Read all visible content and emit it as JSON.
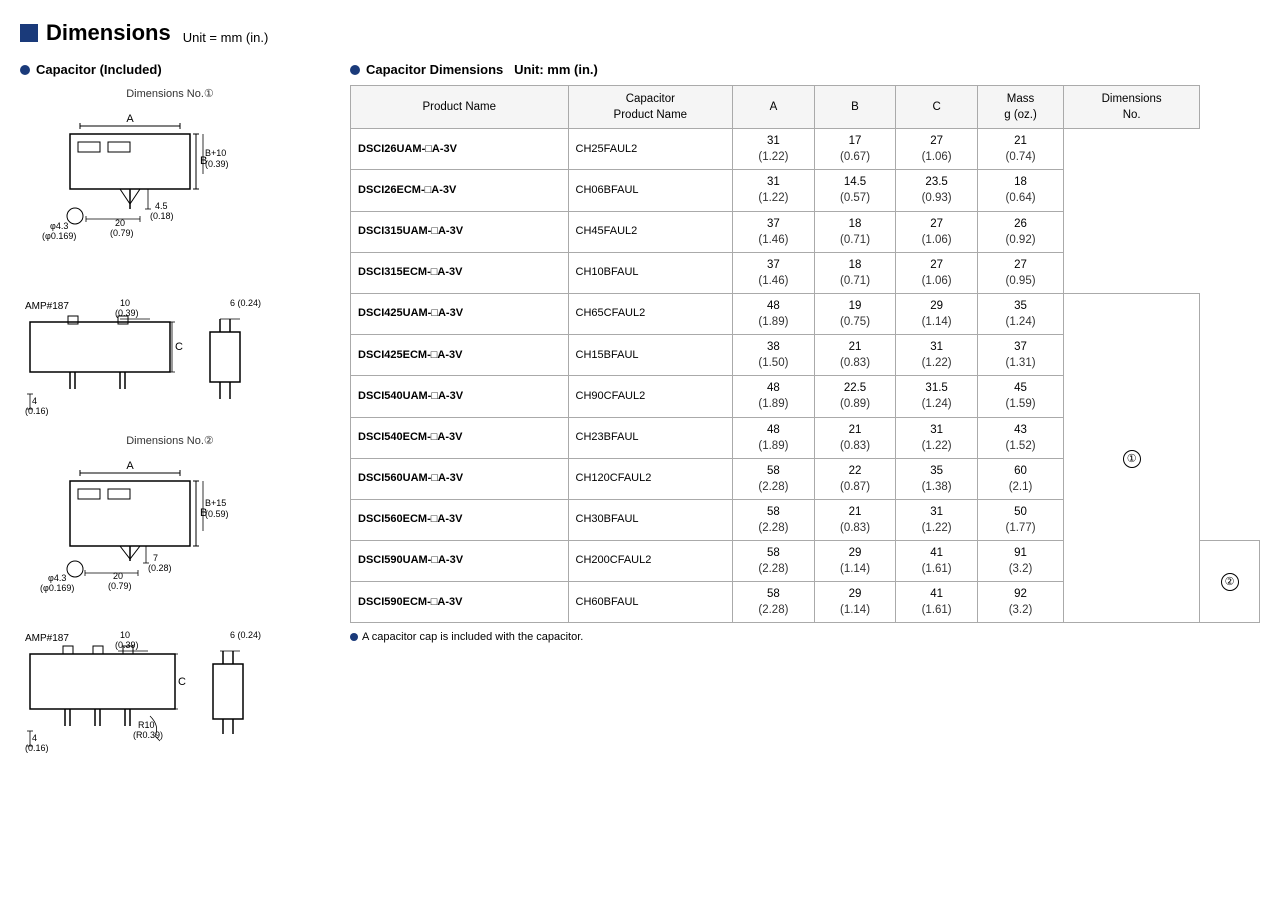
{
  "header": {
    "title": "Dimensions",
    "unit": "Unit = mm (in.)"
  },
  "left_section": {
    "title": "Capacitor (Included)",
    "dim1_label": "Dimensions No.①",
    "dim2_label": "Dimensions No.②"
  },
  "right_section": {
    "title": "Capacitor Dimensions",
    "unit": "Unit: mm (in.)",
    "columns": [
      "Product Name",
      "Capacitor\nProduct Name",
      "A",
      "B",
      "C",
      "Mass\ng (oz.)",
      "Dimensions\nNo."
    ],
    "rows": [
      {
        "product": "DSCI26UAM-□A-3V",
        "cap_product": "CH25FAUL2",
        "a": "31\n(1.22)",
        "b": "17\n(0.67)",
        "c": "27\n(1.06)",
        "mass": "21\n(0.74)",
        "dim_no": ""
      },
      {
        "product": "DSCI26ECM-□A-3V",
        "cap_product": "CH06BFAUL",
        "a": "31\n(1.22)",
        "b": "14.5\n(0.57)",
        "c": "23.5\n(0.93)",
        "mass": "18\n(0.64)",
        "dim_no": ""
      },
      {
        "product": "DSCI315UAM-□A-3V",
        "cap_product": "CH45FAUL2",
        "a": "37\n(1.46)",
        "b": "18\n(0.71)",
        "c": "27\n(1.06)",
        "mass": "26\n(0.92)",
        "dim_no": ""
      },
      {
        "product": "DSCI315ECM-□A-3V",
        "cap_product": "CH10BFAUL",
        "a": "37\n(1.46)",
        "b": "18\n(0.71)",
        "c": "27\n(1.06)",
        "mass": "27\n(0.95)",
        "dim_no": ""
      },
      {
        "product": "DSCI425UAM-□A-3V",
        "cap_product": "CH65CFAUL2",
        "a": "48\n(1.89)",
        "b": "19\n(0.75)",
        "c": "29\n(1.14)",
        "mass": "35\n(1.24)",
        "dim_no": "①"
      },
      {
        "product": "DSCI425ECM-□A-3V",
        "cap_product": "CH15BFAUL",
        "a": "38\n(1.50)",
        "b": "21\n(0.83)",
        "c": "31\n(1.22)",
        "mass": "37\n(1.31)",
        "dim_no": ""
      },
      {
        "product": "DSCI540UAM-□A-3V",
        "cap_product": "CH90CFAUL2",
        "a": "48\n(1.89)",
        "b": "22.5\n(0.89)",
        "c": "31.5\n(1.24)",
        "mass": "45\n(1.59)",
        "dim_no": ""
      },
      {
        "product": "DSCI540ECM-□A-3V",
        "cap_product": "CH23BFAUL",
        "a": "48\n(1.89)",
        "b": "21\n(0.83)",
        "c": "31\n(1.22)",
        "mass": "43\n(1.52)",
        "dim_no": ""
      },
      {
        "product": "DSCI560UAM-□A-3V",
        "cap_product": "CH120CFAUL2",
        "a": "58\n(2.28)",
        "b": "22\n(0.87)",
        "c": "35\n(1.38)",
        "mass": "60\n(2.1)",
        "dim_no": ""
      },
      {
        "product": "DSCI560ECM-□A-3V",
        "cap_product": "CH30BFAUL",
        "a": "58\n(2.28)",
        "b": "21\n(0.83)",
        "c": "31\n(1.22)",
        "mass": "50\n(1.77)",
        "dim_no": ""
      },
      {
        "product": "DSCI590UAM-□A-3V",
        "cap_product": "CH200CFAUL2",
        "a": "58\n(2.28)",
        "b": "29\n(1.14)",
        "c": "41\n(1.61)",
        "mass": "91\n(3.2)",
        "dim_no": "②"
      },
      {
        "product": "DSCI590ECM-□A-3V",
        "cap_product": "CH60BFAUL",
        "a": "58\n(2.28)",
        "b": "29\n(1.14)",
        "c": "41\n(1.61)",
        "mass": "92\n(3.2)",
        "dim_no": ""
      }
    ],
    "footnote": "A capacitor cap is included with the capacitor."
  }
}
